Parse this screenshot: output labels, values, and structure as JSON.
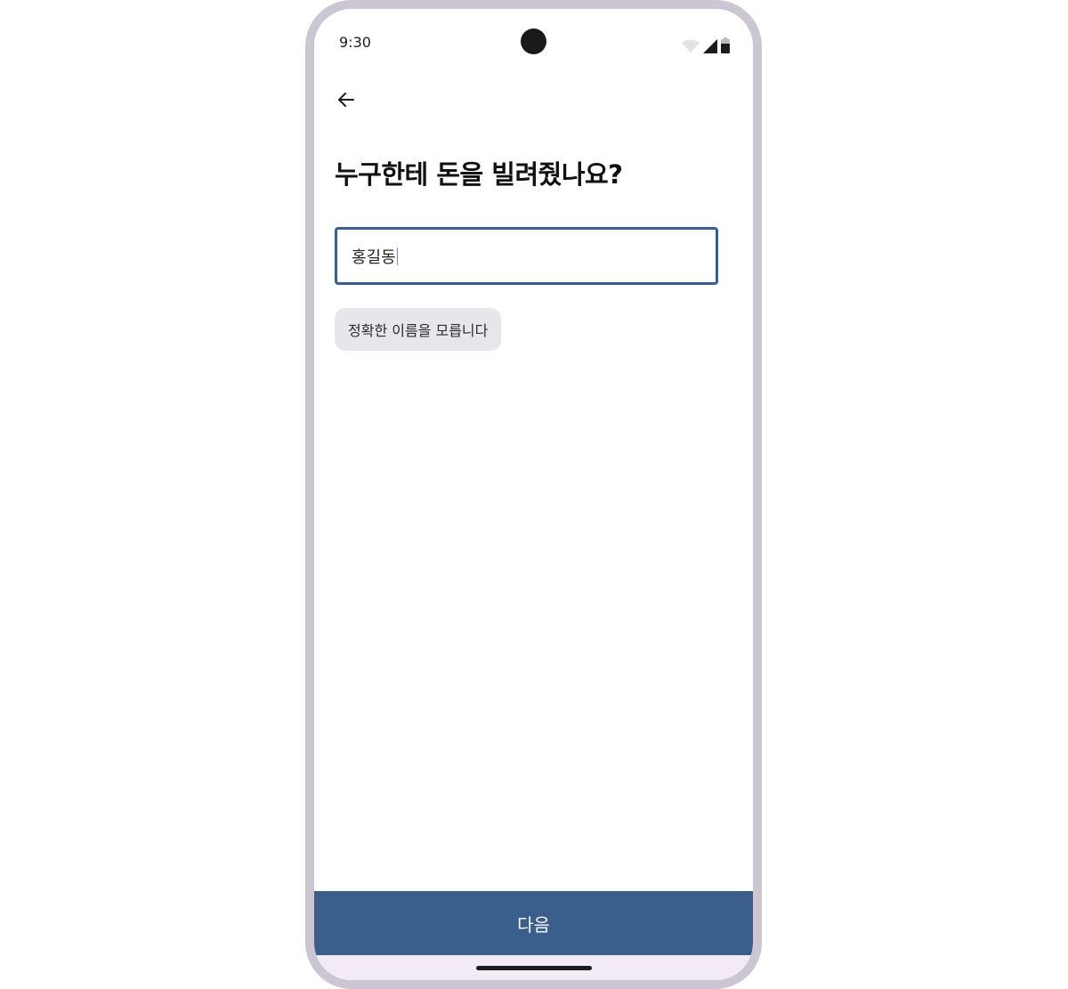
{
  "status_bar": {
    "time": "9:30"
  },
  "header": {
    "back_icon": "arrow-left-icon"
  },
  "main": {
    "title": "누구한테 돈을 빌려줬나요?",
    "input_value": "홍길동",
    "unknown_name_chip": "정확한 이름을 모릅니다"
  },
  "footer": {
    "next_label": "다음"
  },
  "colors": {
    "accent": "#3b5f8c",
    "frame": "#cbc6d1",
    "chip_bg": "#e7e6ea",
    "nav_bg": "#f2ebf5"
  }
}
